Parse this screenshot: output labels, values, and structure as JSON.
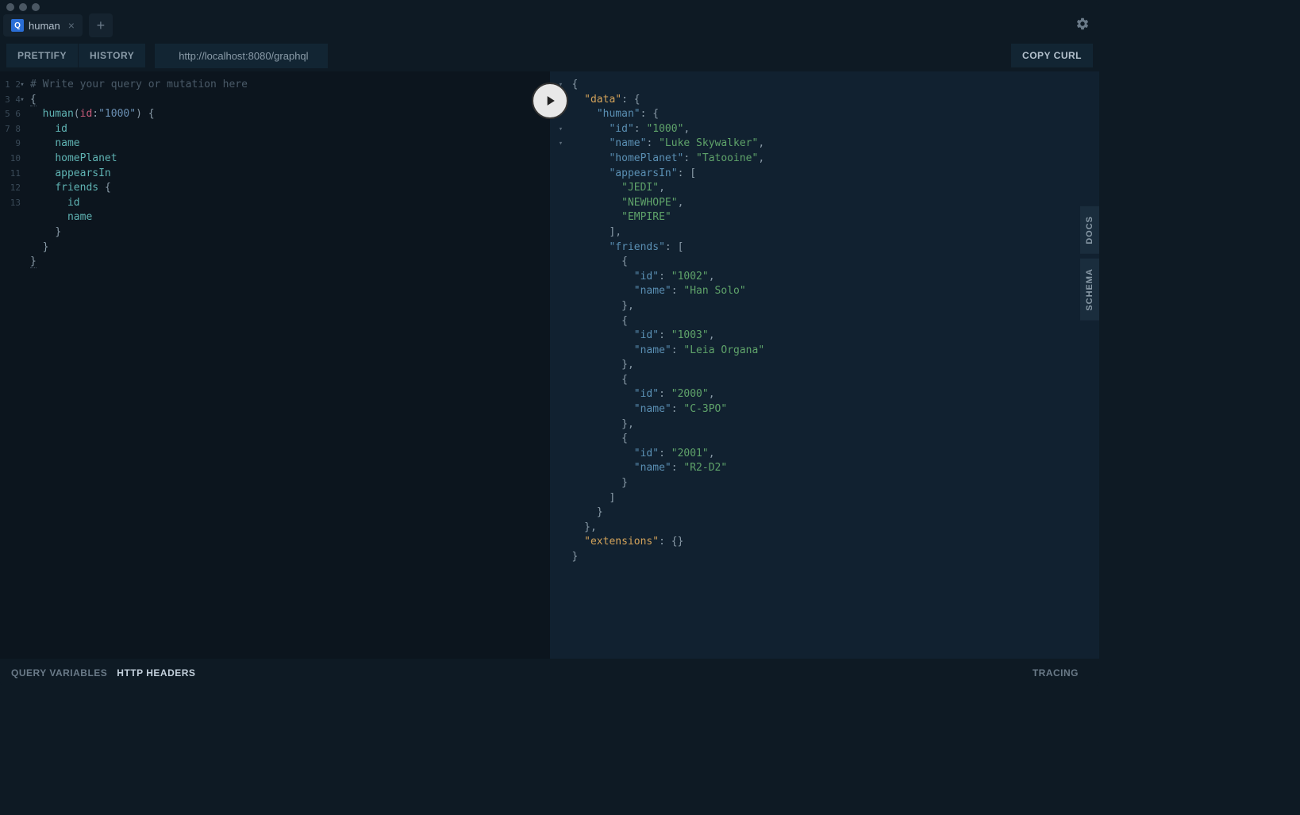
{
  "tab": {
    "label": "human",
    "icon_letter": "Q"
  },
  "toolbar": {
    "prettify": "PRETTIFY",
    "history": "HISTORY",
    "copy_curl": "COPY CURL",
    "url": "http://localhost:8080/graphql"
  },
  "editor": {
    "lines": [
      "1",
      "2",
      "3",
      "4",
      "5",
      "6",
      "7",
      "8",
      "9",
      "10",
      "11",
      "12",
      "13"
    ],
    "query": {
      "comment": "# Write your query or mutation here",
      "root_open": "{",
      "field": "human",
      "arg_name": "id",
      "arg_value": "\"1000\"",
      "fields": [
        "id",
        "name",
        "homePlanet",
        "appearsIn"
      ],
      "friends_label": "friends",
      "friends_fields": [
        "id",
        "name"
      ],
      "close_inner": "}",
      "close_mid": "}",
      "root_close": "}"
    }
  },
  "result": {
    "data": {
      "human": {
        "id": "1000",
        "name": "Luke Skywalker",
        "homePlanet": "Tatooine",
        "appearsIn": [
          "JEDI",
          "NEWHOPE",
          "EMPIRE"
        ],
        "friends": [
          {
            "id": "1002",
            "name": "Han Solo"
          },
          {
            "id": "1003",
            "name": "Leia Organa"
          },
          {
            "id": "2000",
            "name": "C-3PO"
          },
          {
            "id": "2001",
            "name": "R2-D2"
          }
        ]
      }
    },
    "extensions_label": "extensions"
  },
  "side": {
    "docs": "DOCS",
    "schema": "SCHEMA"
  },
  "footer": {
    "query_variables": "QUERY VARIABLES",
    "http_headers": "HTTP HEADERS",
    "tracing": "TRACING"
  }
}
